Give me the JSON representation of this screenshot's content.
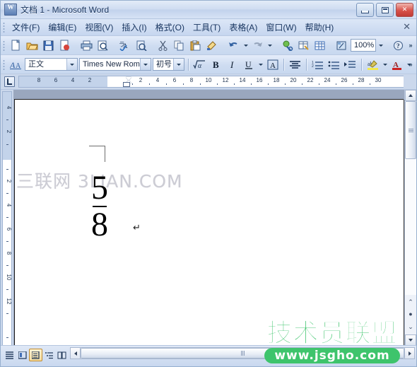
{
  "window": {
    "title": "文档 1 - Microsoft Word",
    "app_icon": "word-icon",
    "minimize_label": "最小化",
    "restore_label": "还原",
    "close_label": "关闭",
    "close_glyph": "✕"
  },
  "menubar": {
    "items": [
      {
        "label": "文件(F)",
        "name": "menu-file"
      },
      {
        "label": "编辑(E)",
        "name": "menu-edit"
      },
      {
        "label": "视图(V)",
        "name": "menu-view"
      },
      {
        "label": "插入(I)",
        "name": "menu-insert"
      },
      {
        "label": "格式(O)",
        "name": "menu-format"
      },
      {
        "label": "工具(T)",
        "name": "menu-tools"
      },
      {
        "label": "表格(A)",
        "name": "menu-table"
      },
      {
        "label": "窗口(W)",
        "name": "menu-window"
      },
      {
        "label": "帮助(H)",
        "name": "menu-help"
      }
    ],
    "doc_close_glyph": "✕"
  },
  "standard_toolbar": {
    "zoom_value": "100%",
    "buttons": [
      "new-document-icon",
      "open-folder-icon",
      "save-disk-icon",
      "mail-recipient-icon",
      "print-icon",
      "print-preview-icon",
      "spelling-check-icon",
      "research-icon",
      "cut-scissors-icon",
      "copy-icon",
      "paste-clipboard-icon",
      "format-painter-icon",
      "undo-icon",
      "redo-icon",
      "insert-hyperlink-icon",
      "insert-table-icon",
      "insert-excel-table-icon",
      "show-formatting-icon",
      "help-icon",
      "underline-toolbar-icon"
    ]
  },
  "formatting_toolbar": {
    "style_value": "正文",
    "font_value": "Times New Roma",
    "size_value": "初号",
    "buttons": [
      "styles-pane-icon",
      "equation-icon",
      "bold-icon",
      "italic-icon",
      "underline-icon",
      "border-icon",
      "align-center-icon",
      "numbered-list-icon",
      "bulleted-list-icon",
      "increase-indent-icon",
      "highlight-icon",
      "font-color-icon"
    ],
    "bold_label": "B",
    "italic_label": "I",
    "underline_label": "U",
    "border_label": "A",
    "font_color_label": "A",
    "highlight_label": "ab",
    "equation_label": "√α",
    "styles_label": "A"
  },
  "ruler": {
    "tab_selector": "left-tab-stop",
    "horizontal_left_margin": [
      "8",
      "6",
      "4",
      "2"
    ],
    "horizontal_right": [
      "2",
      "4",
      "6",
      "8",
      "10",
      "12",
      "14",
      "16",
      "18",
      "20",
      "22",
      "24",
      "26",
      "28",
      "30"
    ],
    "vertical_top": [
      "4",
      "2"
    ],
    "vertical_body": [
      "2",
      "4",
      "6",
      "8",
      "10",
      "12"
    ]
  },
  "document": {
    "watermark_text": "三联网 3LIAN.COM",
    "fraction_numerator": "5",
    "fraction_denominator": "8",
    "paragraph_mark": "↵"
  },
  "status_bar": {
    "view_buttons": [
      {
        "name": "view-normal",
        "glyph": "≡",
        "active": false
      },
      {
        "name": "view-web-layout",
        "glyph": "⊡",
        "active": false
      },
      {
        "name": "view-print-layout",
        "glyph": "⊟",
        "active": true
      },
      {
        "name": "view-outline",
        "glyph": "⋮≡",
        "active": false
      },
      {
        "name": "view-reading-layout",
        "glyph": "▥",
        "active": false
      }
    ]
  },
  "scrollbars": {
    "vertical_up_glyph": "▲",
    "vertical_down_glyph": "▼",
    "horizontal_left_glyph": "◀",
    "horizontal_right_glyph": "▶",
    "browse_prev": "⌃",
    "browse_select": "●",
    "browse_next": "⌄"
  },
  "logo_watermark": {
    "brand": "技术员联盟",
    "url": "www.jsgho.com",
    "color": "#3ec46c"
  },
  "colors": {
    "titlebar": "#cfdcf1",
    "toolbar": "#cedcf1",
    "page": "#ffffff",
    "desk": "#9aa7be",
    "close_button": "#d8514a"
  }
}
